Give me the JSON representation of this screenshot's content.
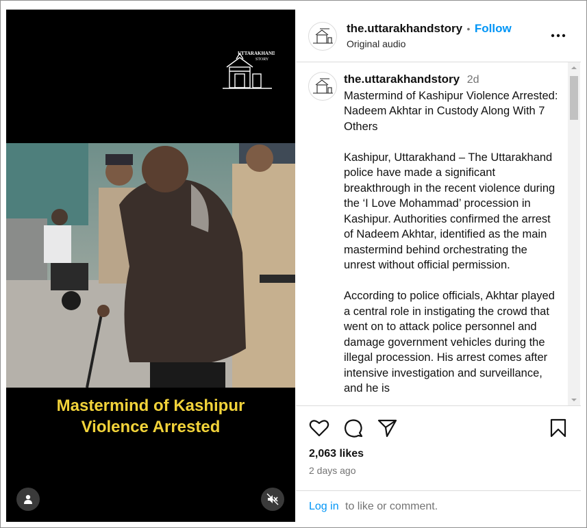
{
  "video": {
    "watermark_line1": "UTTARAKHAND",
    "watermark_line2": "STORY",
    "caption_line1": "Mastermind of Kashipur",
    "caption_line2": "Violence Arrested",
    "user_icon": "user-icon",
    "mute_icon": "muted-speaker-icon"
  },
  "header": {
    "username": "the.uttarakhandstory",
    "separator": "•",
    "follow_label": "Follow",
    "subtitle": "Original audio",
    "more_icon": "more-options-icon"
  },
  "post": {
    "username": "the.uttarakhandstory",
    "time_ago": "2d",
    "title": "Mastermind of Kashipur Violence Arrested: Nadeem Akhtar in Custody Along With 7 Others",
    "paragraph1": "Kashipur, Uttarakhand – The Uttarakhand police have made a significant breakthrough in the recent violence during the ‘I Love Mohammad’ procession in Kashipur. Authorities confirmed the arrest of Nadeem Akhtar, identified as the main mastermind behind orchestrating the unrest without official permission.",
    "paragraph2": "According to police officials, Akhtar played a central role in instigating the crowd that went on to attack police personnel and damage government vehicles during the illegal procession. His arrest comes after intensive investigation and surveillance, and he is"
  },
  "actions": {
    "like_icon": "heart-icon",
    "comment_icon": "comment-icon",
    "share_icon": "share-icon",
    "save_icon": "bookmark-icon"
  },
  "stats": {
    "likes": "2,063 likes",
    "posted": "2 days ago"
  },
  "login": {
    "link_label": "Log in",
    "rest": "to like or comment."
  },
  "colors": {
    "accent": "#0095f6",
    "caption": "#f2d33a"
  }
}
